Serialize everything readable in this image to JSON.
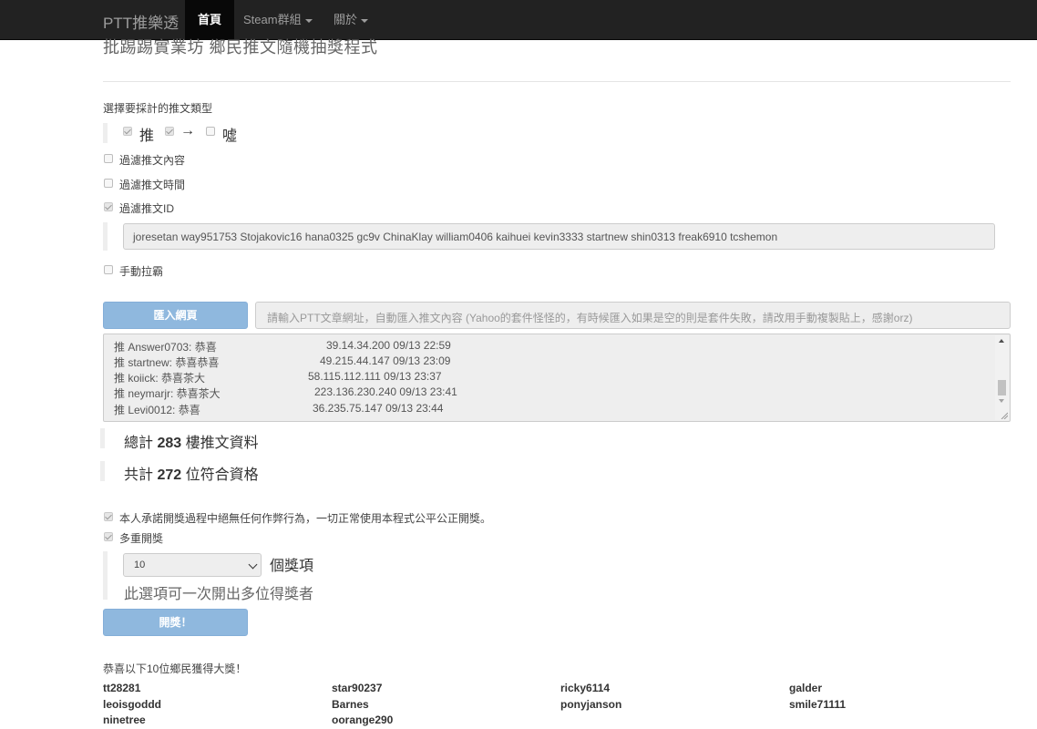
{
  "navbar": {
    "brand": "PTT推樂透",
    "home": "首頁",
    "steam": "Steam群組",
    "about": "關於"
  },
  "subtitle": "批踢踢實業坊 鄉民推文隨機抽獎程式",
  "type_section": {
    "heading": "選擇要採計的推文類型",
    "push_label": "推",
    "arrow_label": "→",
    "boo_label": "噓",
    "push_checked": true,
    "arrow_checked": true,
    "boo_checked": false
  },
  "filters": {
    "content": "過濾推文內容",
    "time": "過濾推文時間",
    "id": "過濾推文ID",
    "id_checked": true,
    "id_list": "joresetan way951753 Stojakovic16 hana0325 gc9v ChinaKlay william0406 kaihuei kevin3333 startnew shin0313 freak6910 tcshemon",
    "manual": "手動拉霸"
  },
  "import": {
    "button": "匯入網頁",
    "placeholder": "請輸入PTT文章網址，自動匯入推文內容 (Yahoo的套件怪怪的，有時候匯入如果是空的則是套件失敗，請改用手動複製貼上，感謝orz)"
  },
  "pushes": [
    {
      "text": "推 Answer0703: 恭喜",
      "meta": "39.14.34.200 09/13 22:59"
    },
    {
      "text": "推 startnew: 恭喜恭喜",
      "meta": "49.215.44.147 09/13 23:09"
    },
    {
      "text": "推 koiick: 恭喜茶大",
      "meta": "58.115.112.111 09/13 23:37"
    },
    {
      "text": "推 neymarjr: 恭喜茶大",
      "meta": "223.136.230.240 09/13 23:41"
    },
    {
      "text": "推 Levi0012: 恭喜",
      "meta": "36.235.75.147 09/13 23:44"
    }
  ],
  "stats": {
    "total_prefix": "總計",
    "total_count": "283",
    "total_suffix": "樓推文資料",
    "eligible_prefix": "共計",
    "eligible_count": "272",
    "eligible_suffix": "位符合資格"
  },
  "draw": {
    "promise": "本人承諾開獎過程中絕無任何作弊行為，一切正常使用本程式公平公正開獎。",
    "multi": "多重開獎",
    "count_value": "10",
    "count_suffix": "個獎項",
    "hint": "此選項可一次開出多位得獎者",
    "button": "開獎！"
  },
  "results": {
    "heading": "恭喜以下10位鄉民獲得大獎！",
    "winners": [
      "tt28281",
      "star90237",
      "ricky6114",
      "galder",
      "leoisgoddd",
      "Barnes",
      "ponyjanson",
      "smile71111",
      "ninetree",
      "oorange290"
    ]
  }
}
